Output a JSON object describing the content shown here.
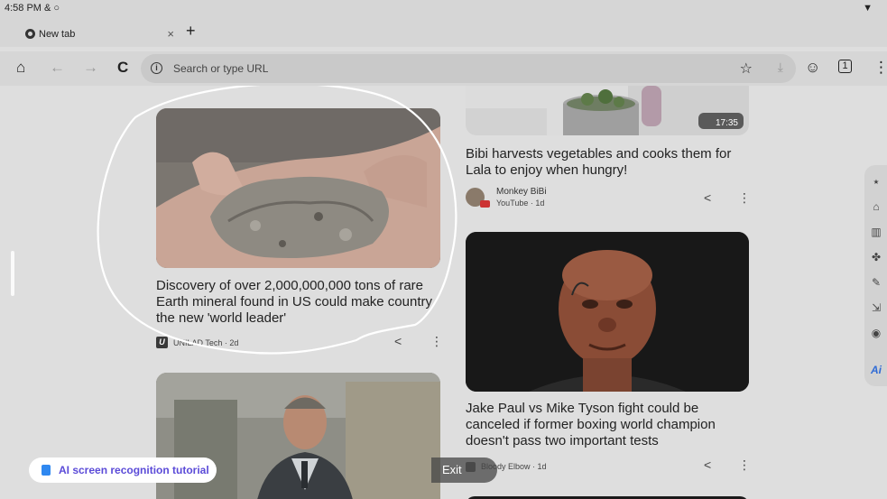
{
  "status_bar": {
    "time": "4:58 PM & ○",
    "wifi": "▼"
  },
  "tabs": [
    {
      "title": "New tab",
      "close": "×"
    }
  ],
  "new_tab": "+",
  "toolbar": {
    "home": "⌂",
    "back": "←",
    "forward": "→",
    "reload": "C",
    "omnibox_placeholder": "Search or type URL",
    "info": "i",
    "bookmark": "☆",
    "download": "⤓",
    "account": "☺",
    "tab_count": "1",
    "menu": "⋮"
  },
  "feed": {
    "left": [
      {
        "headline": "Discovery of over 2,000,000,000 tons of rare Earth mineral found in US could make country the new 'world leader'",
        "source": "UNILAD Tech · 2d",
        "source_logo": "U",
        "image": "rare-earth-rock-in-hand"
      },
      {
        "headline": "",
        "source": "",
        "image": "man-in-suit-photo"
      }
    ],
    "right": [
      {
        "headline": "Bibi harvests vegetables and cooks them for Lala to enjoy when hungry!",
        "source_name": "Monkey BiBi",
        "source_meta": "YouTube · 1d",
        "video_duration": "17:35",
        "image": "cooking-pot-video"
      },
      {
        "headline": "Jake Paul vs Mike Tyson fight could be canceled if former boxing world champion doesn't pass two important tests",
        "source": "Bloody Elbow · 1d",
        "image": "mike-tyson-portrait"
      }
    ],
    "share_icon": "<",
    "more_icon": "⋮"
  },
  "side_tools": [
    {
      "name": "back-tool-icon",
      "glyph": "⭑"
    },
    {
      "name": "home-tool-icon",
      "glyph": "⌂"
    },
    {
      "name": "split-tool-icon",
      "glyph": "▥"
    },
    {
      "name": "gamepad-tool-icon",
      "glyph": "✤"
    },
    {
      "name": "pen-tool-icon",
      "glyph": "✎"
    },
    {
      "name": "screenshot-tool-icon",
      "glyph": "⇲"
    },
    {
      "name": "record-tool-icon",
      "glyph": "◉"
    },
    {
      "name": "ai-tool-icon",
      "glyph": "Ai"
    }
  ],
  "ai_tutorial_label": "AI screen recognition tutorial",
  "exit_label": "Exit",
  "colors": {
    "background": "#dedede",
    "ai_accent": "#5b4bd8",
    "annotation_stroke": "#ffffff"
  }
}
